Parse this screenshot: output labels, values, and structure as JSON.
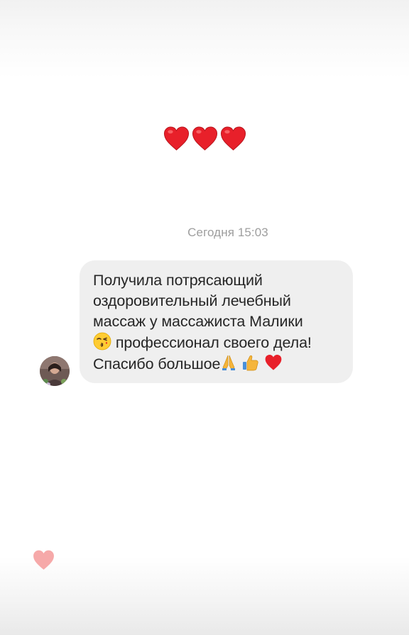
{
  "reaction": {
    "icons": [
      "red-heart-icon",
      "red-heart-icon",
      "red-heart-icon"
    ]
  },
  "thread": {
    "timestamp": "Сегодня 15:03"
  },
  "message": {
    "line1": "Получила потрясающий",
    "line2": "оздоровительный лечебный",
    "line3": "массаж у массажиста Малики",
    "line4": "профессионал своего дела!",
    "line5": "Спасибо большое",
    "emojis": [
      "kissing-face-icon",
      "folded-hands-icon",
      "thumbs-up-icon",
      "red-heart-icon"
    ]
  },
  "colors": {
    "heart": "#e8202a",
    "like_heart": "#f6a9a9",
    "bubble_bg": "#efefef",
    "timestamp": "#9e9e9e",
    "text": "#262626"
  }
}
